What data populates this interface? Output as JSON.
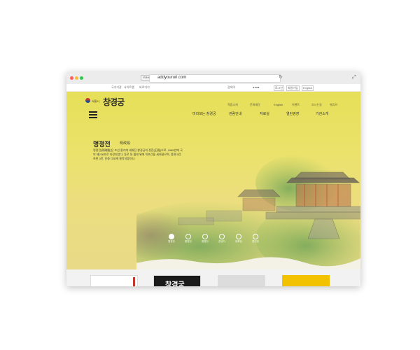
{
  "browser": {
    "segment_label": "ISBN/pdf",
    "url": "addyoururl.com"
  },
  "util_bar": {
    "left_links": [
      "국가기관",
      "사이트맵",
      "바로가기"
    ],
    "search_placeholder": "검색어",
    "search_hint": "●●●●",
    "buttons": [
      "로그인",
      "회원가입",
      "English"
    ],
    "top_links": [
      "작품소개",
      "문화재단",
      "English",
      "이벤트",
      "오시는길",
      "유튜브"
    ]
  },
  "header": {
    "logo_sub": "서울시",
    "logo_main": "창경궁",
    "nav": [
      "미리보는 창경궁",
      "관람안내",
      "자료실",
      "열린광장",
      "기관소개"
    ]
  },
  "hero": {
    "title": "명정전",
    "hanja": "明政殿",
    "desc": "명정전(明政殿)은 조선 중기에 세워진 창경궁의 정전(正殿)으로, 1985년에 국보 제226호로 지정되었다. 동로 된 월대 위에 육포간을 세워졌으며, 정면 5칸, 측면 3칸, 단층 다포계 팔작지붕이다."
  },
  "slider": {
    "items": [
      "명정전",
      "통명전",
      "환경전",
      "춘당지",
      "양화당",
      "함인정"
    ],
    "active_index": 0
  },
  "cards": [
    "",
    "창경궁",
    "",
    ""
  ],
  "colors": {
    "hero_bg": "#e6df58",
    "accent_gold": "#f2c200",
    "dark": "#1a1a1a"
  }
}
